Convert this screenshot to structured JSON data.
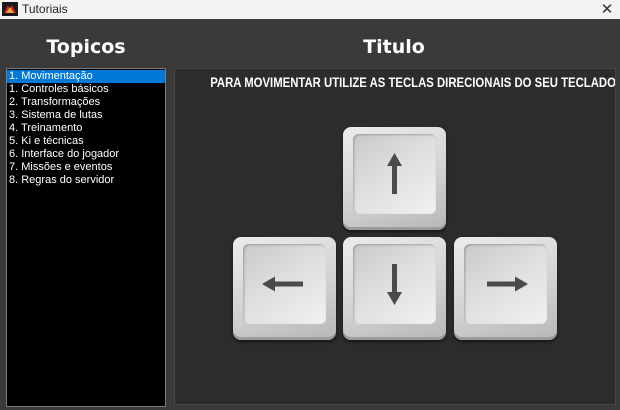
{
  "window": {
    "title": "Tutoriais",
    "close_glyph": "✕",
    "app_icon": "app-logo-icon"
  },
  "topics": {
    "heading": "Topicos",
    "items": [
      {
        "label": "1. Movimentação",
        "selected": true
      },
      {
        "label": "1. Controles básicos",
        "selected": false
      },
      {
        "label": "2. Transformações",
        "selected": false
      },
      {
        "label": "3. Sistema de lutas",
        "selected": false
      },
      {
        "label": "4. Treinamento",
        "selected": false
      },
      {
        "label": "5. Ki e técnicas",
        "selected": false
      },
      {
        "label": "6. Interface do jogador",
        "selected": false
      },
      {
        "label": "7. Missões e eventos",
        "selected": false
      },
      {
        "label": "8. Regras do servidor",
        "selected": false
      }
    ]
  },
  "content": {
    "heading": "Titulo",
    "instruction": "PARA MOVIMENTAR UTILIZE AS TECLAS DIRECIONAIS DO SEU TECLADO",
    "keys": [
      {
        "name": "arrow-up-key",
        "icon": "arrow-up-icon"
      },
      {
        "name": "arrow-left-key",
        "icon": "arrow-left-icon"
      },
      {
        "name": "arrow-down-key",
        "icon": "arrow-down-icon"
      },
      {
        "name": "arrow-right-key",
        "icon": "arrow-right-icon"
      }
    ]
  },
  "colors": {
    "selection": "#0078d7",
    "window_bg": "#3a3a3a",
    "list_bg": "#000000",
    "content_bg": "#2c2c2c"
  }
}
